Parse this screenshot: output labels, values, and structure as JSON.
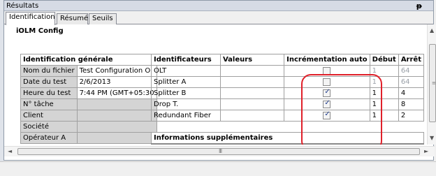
{
  "panel": {
    "title": "Résultats",
    "pin_glyph": "ᵽ",
    "close_glyph": "x"
  },
  "tabs": [
    "Identification",
    "Résumé",
    "Seuils"
  ],
  "section_title": "iOLM Config",
  "general": {
    "header": "Identification générale",
    "rows": [
      {
        "label": "Nom du fichier",
        "value": "Test Configuration O"
      },
      {
        "label": "Date du test",
        "value": "2/6/2013"
      },
      {
        "label": "Heure du test",
        "value": "7:44 PM (GMT+05:30"
      },
      {
        "label": "N° tâche",
        "value": ""
      },
      {
        "label": "Client",
        "value": ""
      },
      {
        "label": "Société",
        "value": ""
      },
      {
        "label": "Opérateur A",
        "value": ""
      }
    ]
  },
  "identifiers": {
    "headers": [
      "Identificateurs",
      "Valeurs",
      "Incrémentation auto",
      "Début",
      "Arrêt"
    ],
    "rows": [
      {
        "name": "OLT",
        "value": "",
        "auto": false,
        "start": "1",
        "stop": "64",
        "muted": true
      },
      {
        "name": "Splitter A",
        "value": "",
        "auto": false,
        "start": "1",
        "stop": "64",
        "muted": true
      },
      {
        "name": "Splitter B",
        "value": "",
        "auto": true,
        "start": "1",
        "stop": "4",
        "muted": false
      },
      {
        "name": "Drop T.",
        "value": "",
        "auto": true,
        "start": "1",
        "stop": "8",
        "muted": false
      },
      {
        "name": "Redundant Fiber",
        "value": "",
        "auto": true,
        "start": "1",
        "stop": "2",
        "muted": false
      }
    ]
  },
  "additional_info": {
    "header": "Informations supplémentaires"
  },
  "highlight_color": "#e0202a",
  "scrollbar": {
    "h_grip": "III",
    "v_grip": "≡",
    "up": "▲",
    "down": "▼",
    "left": "◄",
    "right": "►"
  }
}
